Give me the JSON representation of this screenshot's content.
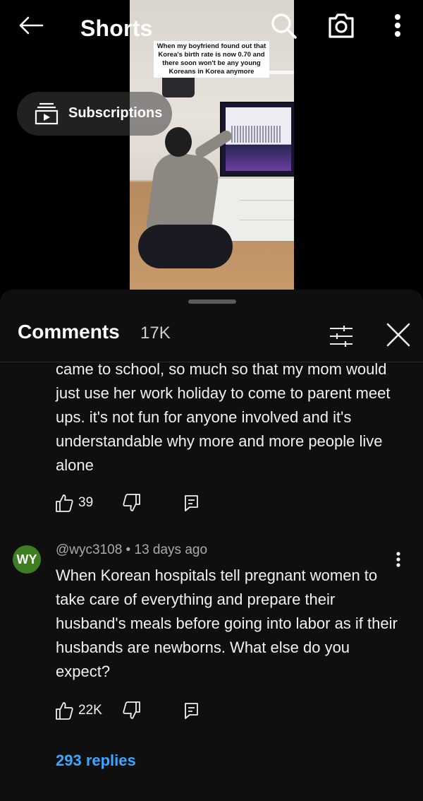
{
  "header": {
    "title": "Shorts",
    "back_icon": "back-arrow-icon",
    "search_icon": "search-icon",
    "camera_icon": "camera-icon",
    "more_icon": "more-vertical-icon"
  },
  "subscriptions": {
    "label": "Subscriptions",
    "icon": "subscriptions-icon"
  },
  "video": {
    "caption": "When my boyfriend found out that Korea's birth rate is now 0.70 and there soon won't be any young Koreans in Korea anymore"
  },
  "comments_panel": {
    "title": "Comments",
    "count": "17K",
    "filter_icon": "filter-icon",
    "close_icon": "close-icon",
    "comments": [
      {
        "text": "came to school, so much so that my mom would just use her work holiday to come to parent meet ups. it's not fun for anyone involved and it's understandable why more and more people live alone",
        "likes": "39"
      },
      {
        "avatar_initials": "WY",
        "author": "@wyc3108",
        "separator": " • ",
        "time": "13 days ago",
        "text": "When Korean hospitals tell pregnant women to take care of everything and prepare their husband's meals before going into labor as if their husbands are newborns. What else do you expect?",
        "likes": "22K",
        "replies": "293 replies"
      }
    ]
  },
  "colors": {
    "background": "#0f0f0f",
    "link": "#3ea6ff",
    "avatar": "#3f7d23",
    "muted_text": "#aaaaaa"
  }
}
